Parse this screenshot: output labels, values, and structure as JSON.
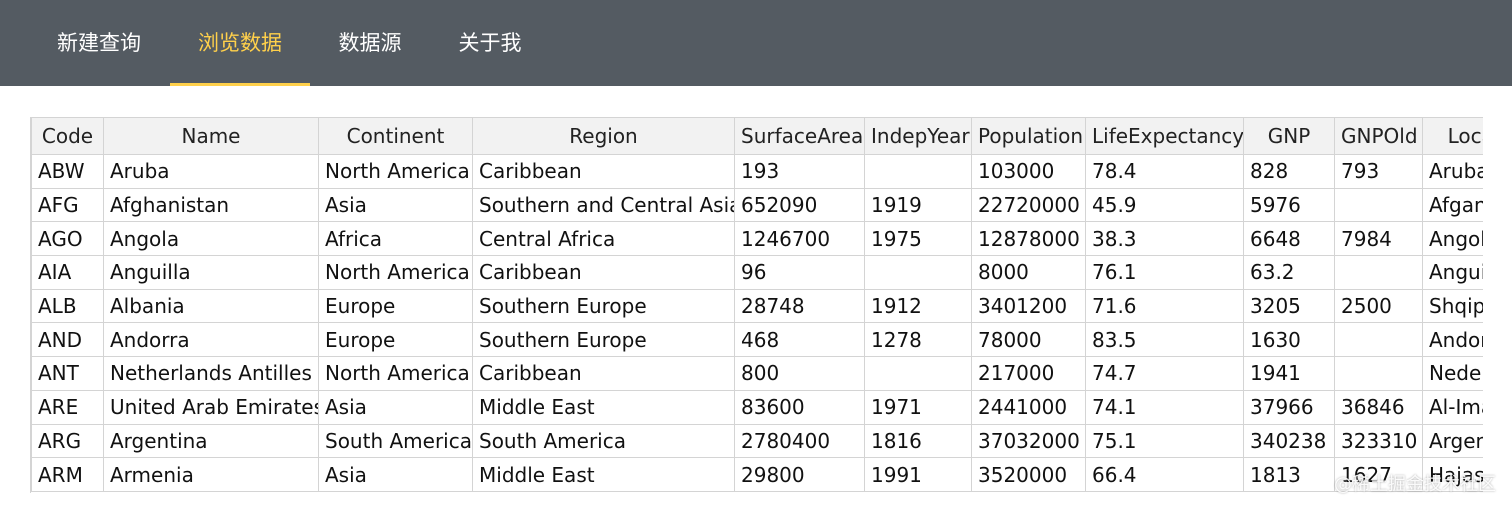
{
  "nav": {
    "items": [
      {
        "label": "新建查询",
        "active": false
      },
      {
        "label": "浏览数据",
        "active": true
      },
      {
        "label": "数据源",
        "active": false
      },
      {
        "label": "关于我",
        "active": false
      }
    ],
    "accent_color": "#ffd04b",
    "background_color": "#545b62"
  },
  "table": {
    "columns": [
      "Code",
      "Name",
      "Continent",
      "Region",
      "SurfaceArea",
      "IndepYear",
      "Population",
      "LifeExpectancy",
      "GNP",
      "GNPOld",
      "LocalName"
    ],
    "rows": [
      [
        "ABW",
        "Aruba",
        "North America",
        "Caribbean",
        "193",
        "",
        "103000",
        "78.4",
        "828",
        "793",
        "Aruba"
      ],
      [
        "AFG",
        "Afghanistan",
        "Asia",
        "Southern and Central Asia",
        "652090",
        "1919",
        "22720000",
        "45.9",
        "5976",
        "",
        "Afganistan/Afqanestan"
      ],
      [
        "AGO",
        "Angola",
        "Africa",
        "Central Africa",
        "1246700",
        "1975",
        "12878000",
        "38.3",
        "6648",
        "7984",
        "Angola"
      ],
      [
        "AIA",
        "Anguilla",
        "North America",
        "Caribbean",
        "96",
        "",
        "8000",
        "76.1",
        "63.2",
        "",
        "Anguilla"
      ],
      [
        "ALB",
        "Albania",
        "Europe",
        "Southern Europe",
        "28748",
        "1912",
        "3401200",
        "71.6",
        "3205",
        "2500",
        "Shqipëria"
      ],
      [
        "AND",
        "Andorra",
        "Europe",
        "Southern Europe",
        "468",
        "1278",
        "78000",
        "83.5",
        "1630",
        "",
        "Andorra"
      ],
      [
        "ANT",
        "Netherlands Antilles",
        "North America",
        "Caribbean",
        "800",
        "",
        "217000",
        "74.7",
        "1941",
        "",
        "Nederlandse Antillen"
      ],
      [
        "ARE",
        "United Arab Emirates",
        "Asia",
        "Middle East",
        "83600",
        "1971",
        "2441000",
        "74.1",
        "37966",
        "36846",
        "Al-Imarat al-´Arabiya al-Muttahida"
      ],
      [
        "ARG",
        "Argentina",
        "South America",
        "South America",
        "2780400",
        "1816",
        "37032000",
        "75.1",
        "340238",
        "323310",
        "Argentina"
      ],
      [
        "ARM",
        "Armenia",
        "Asia",
        "Middle East",
        "29800",
        "1991",
        "3520000",
        "66.4",
        "1813",
        "1627",
        "Hajastan"
      ]
    ]
  },
  "watermark": "@稀土掘金技术社区"
}
